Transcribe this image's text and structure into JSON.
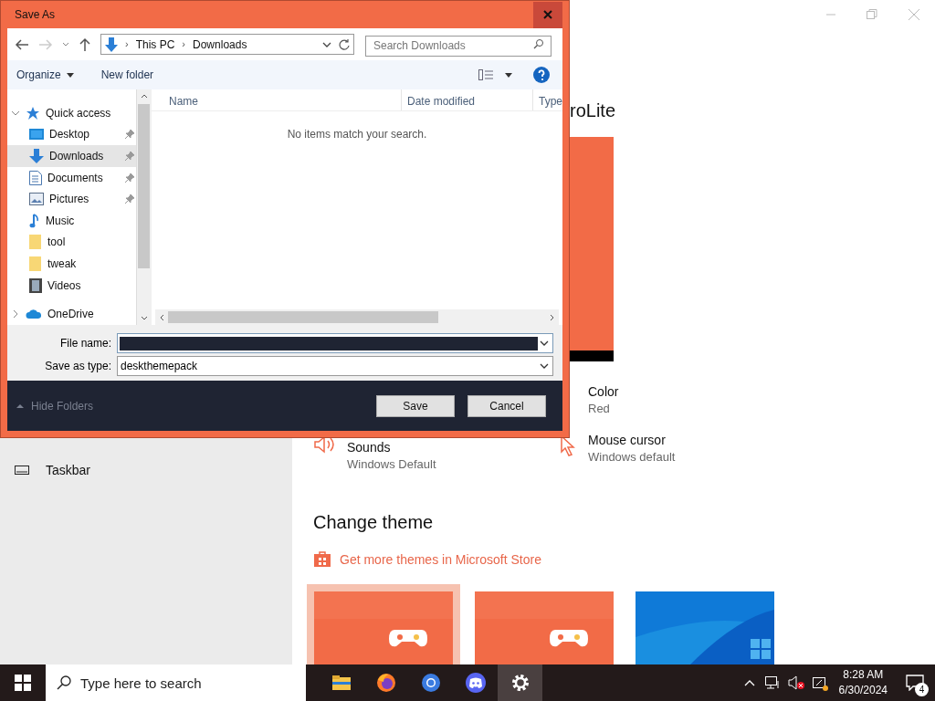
{
  "settings_window": {
    "heading_fragment": "roLite",
    "items": [
      {
        "label": "Color",
        "value": "Red"
      },
      {
        "label": "Sounds",
        "value": "Windows Default"
      },
      {
        "label": "Mouse cursor",
        "value": "Windows default"
      }
    ],
    "sidebar_item": "Taskbar",
    "change_theme": {
      "title": "Change theme",
      "store_link": "Get more themes in Microsoft Store",
      "themes": [
        {
          "selected": true,
          "kind": "game"
        },
        {
          "selected": false,
          "kind": "game"
        },
        {
          "selected": false,
          "kind": "windows"
        }
      ]
    }
  },
  "dialog": {
    "title": "Save As",
    "breadcrumb": [
      {
        "separator": "›",
        "label": "This PC"
      },
      {
        "separator": "›",
        "label": "Downloads"
      }
    ],
    "search": {
      "placeholder": "Search Downloads"
    },
    "toolbar": [
      "Organize",
      "New folder"
    ],
    "tree": [
      {
        "label": "Quick access",
        "expanded": true,
        "children": [
          {
            "label": "Desktop",
            "pinned": true,
            "selected": false
          },
          {
            "label": "Downloads",
            "pinned": true,
            "selected": true
          },
          {
            "label": "Documents",
            "pinned": true,
            "selected": false
          },
          {
            "label": "Pictures",
            "pinned": true,
            "selected": false
          },
          {
            "label": "Music",
            "pinned": false,
            "selected": false
          },
          {
            "label": "tool",
            "pinned": false,
            "selected": false
          },
          {
            "label": "tweak",
            "pinned": false,
            "selected": false
          },
          {
            "label": "Videos",
            "pinned": false,
            "selected": false
          }
        ]
      },
      {
        "label": "OneDrive",
        "expanded": false
      }
    ],
    "columns": [
      "Name",
      "Date modified",
      "Type"
    ],
    "empty_message": "No items match your search.",
    "file_name": {
      "label": "File name:"
    },
    "save_as_type": {
      "label": "Save as type:",
      "value": "deskthemepack"
    },
    "hide_folders": "Hide Folders",
    "buttons": [
      "Save",
      "Cancel"
    ]
  },
  "taskbar": {
    "search": {
      "placeholder": "Type here to search"
    },
    "apps": [
      {
        "selected": false
      },
      {
        "selected": false
      },
      {
        "selected": false
      },
      {
        "selected": false
      },
      {
        "selected": true
      }
    ],
    "time": "8:28 AM",
    "date": "6/30/2024",
    "notifications": "4"
  }
}
